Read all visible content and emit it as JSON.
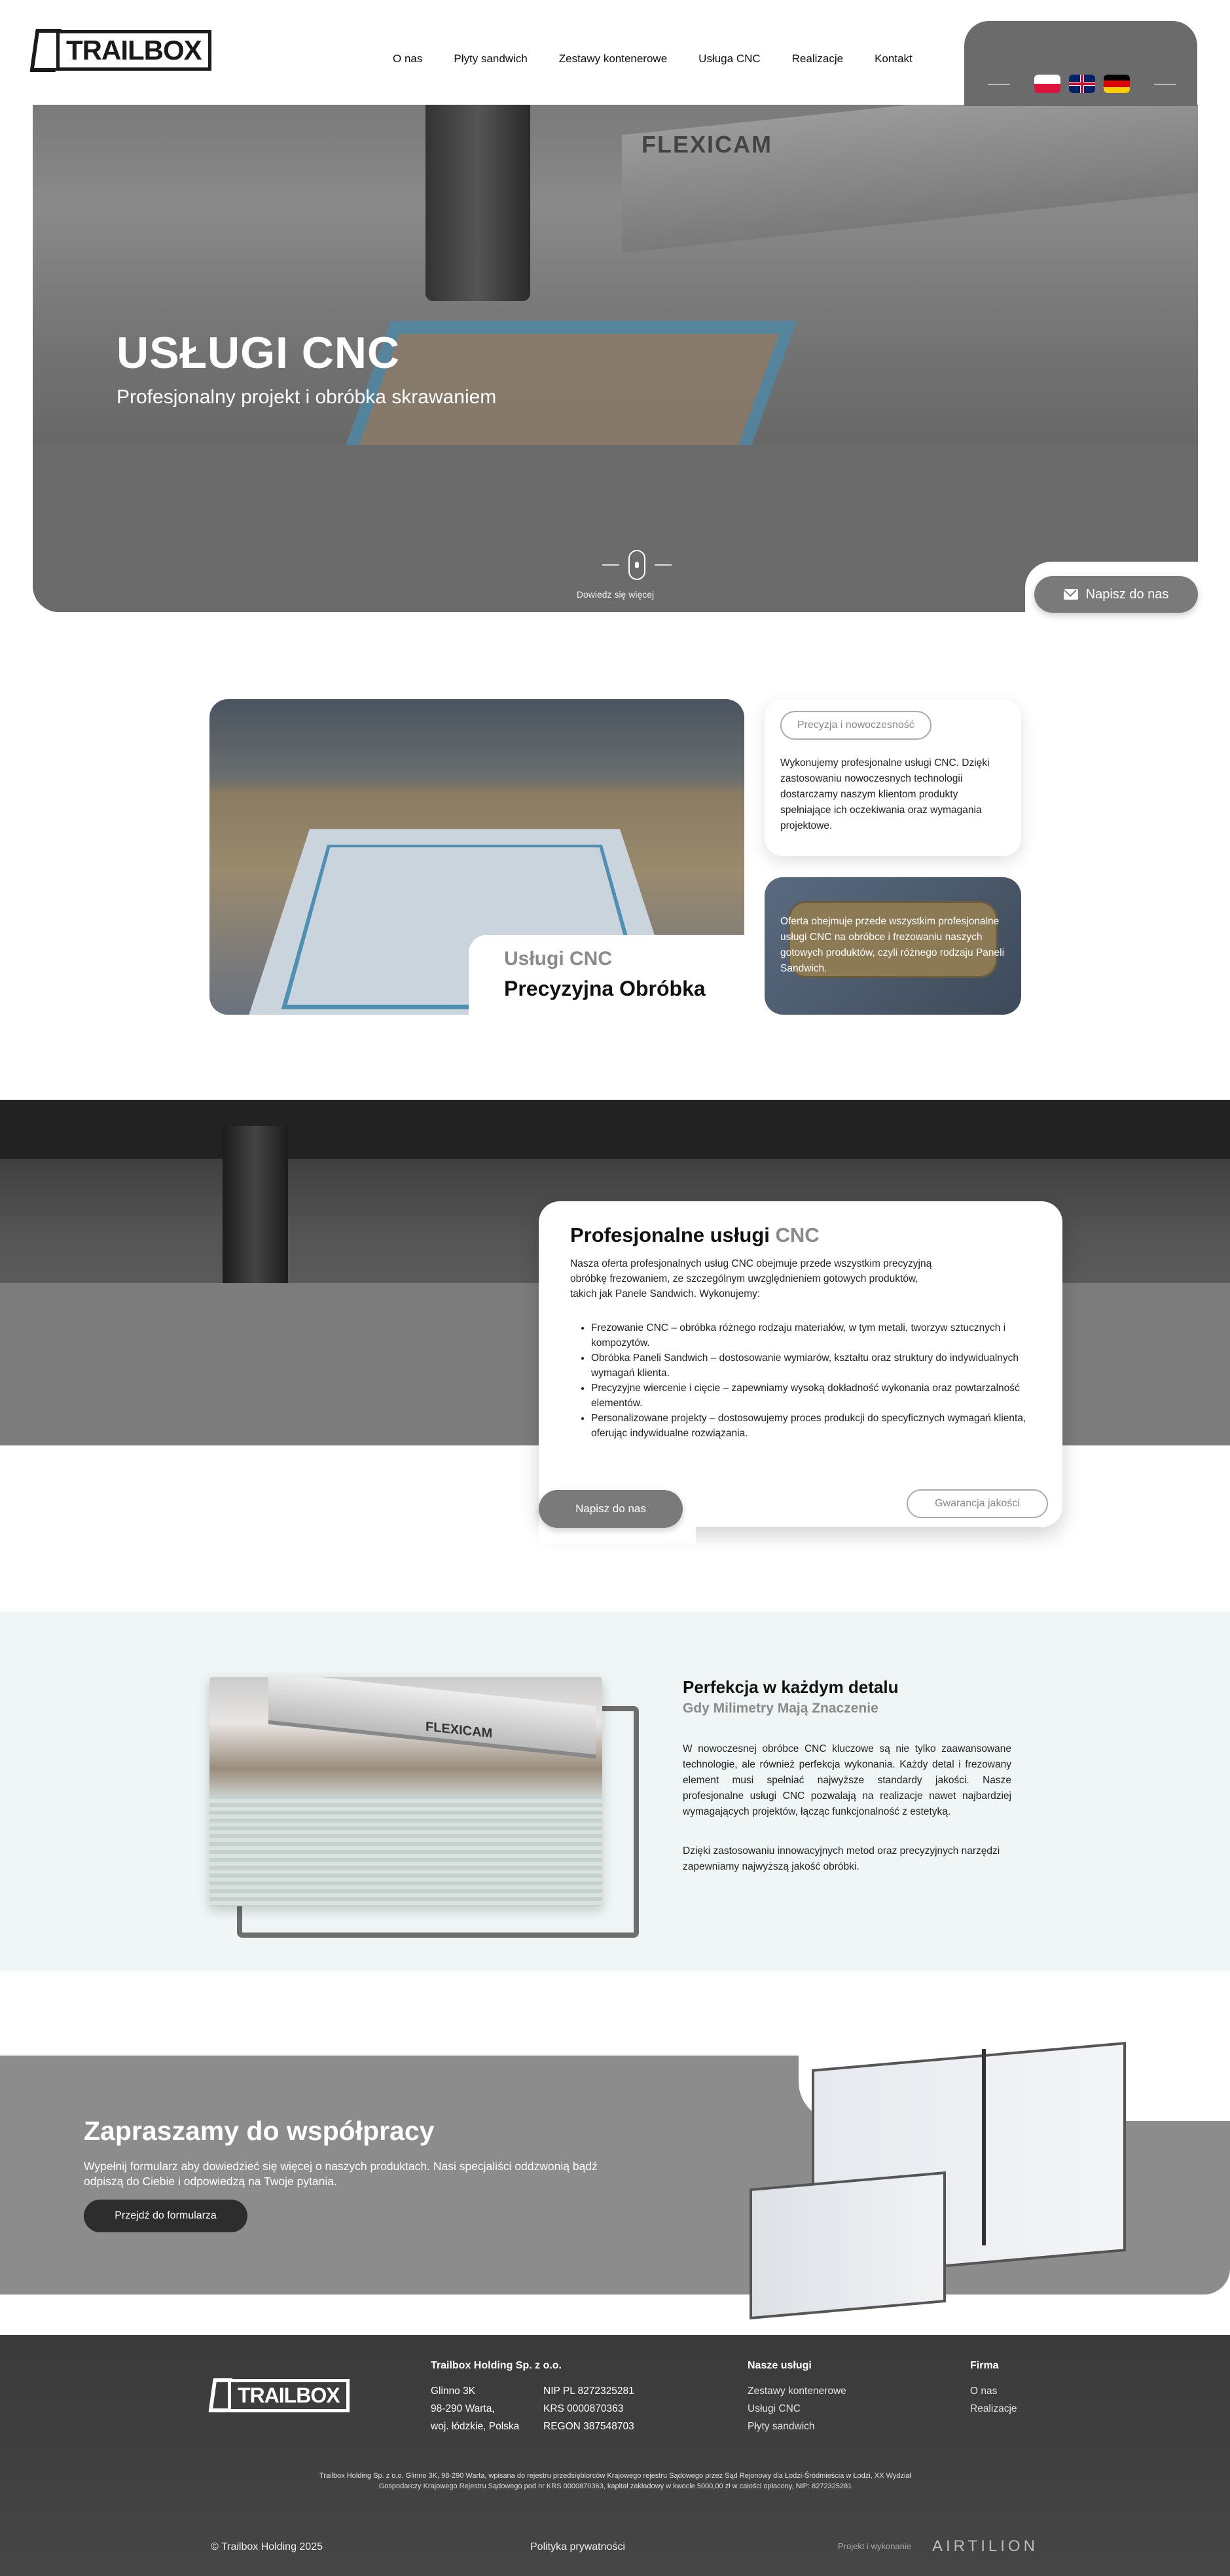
{
  "brand": {
    "logo_text": "TRAILBOX"
  },
  "nav": {
    "items": [
      "O nas",
      "Płyty sandwich",
      "Zestawy kontenerowe",
      "Usługa CNC",
      "Realizacje",
      "Kontakt"
    ]
  },
  "languages": [
    "pl",
    "en",
    "de"
  ],
  "hero": {
    "title": "USŁUGI CNC",
    "subtitle": "Profesjonalny projekt i obróbka skrawaniem",
    "scroll_label": "Dowiedz się więcej",
    "contact_button": "Napisz do nas"
  },
  "intro": {
    "label_gray": "Usługi CNC",
    "label_dark": "Precyzyjna Obróbka",
    "pill": "Precyzja i nowoczesność",
    "box1_text": "Wykonujemy profesjonalne usługi CNC. Dzięki zastosowaniu nowoczesnych technologii dostarczamy naszym klientom produkty spełniające ich oczekiwania oraz wymagania projektowe.",
    "box2_text": "Oferta obejmuje przede wszystkim profesjonalne usługi CNC na obróbce i frezowaniu naszych gotowych produktów, czyli różnego rodzaju Paneli Sandwich."
  },
  "services": {
    "title_dark": "Profesjonalne usługi",
    "title_gray": "CNC",
    "intro": "Nasza oferta profesjonalnych usług CNC obejmuje przede wszystkim precyzyjną obróbkę frezowaniem, ze szczególnym uwzględnieniem gotowych produktów, takich jak Panele Sandwich. Wykonujemy:",
    "list": [
      "Frezowanie CNC – obróbka różnego rodzaju materiałów, w tym metali, tworzyw sztucznych i kompozytów.",
      "Obróbka Paneli Sandwich – dostosowanie wymiarów, kształtu oraz struktury do indywidualnych wymagań klienta.",
      "Precyzyjne wiercenie i cięcie – zapewniamy wysoką dokładność wykonania oraz powtarzalność elementów.",
      "Personalizowane projekty – dostosowujemy proces produkcji do specyficznych wymagań klienta, oferując indywidualne rozwiązania."
    ],
    "button": "Napisz do nas",
    "pill": "Gwarancja jakości"
  },
  "detail": {
    "title": "Perfekcja w każdym detalu",
    "subtitle": "Gdy Milimetry Mają Znaczenie",
    "p1": "W nowoczesnej obróbce CNC kluczowe są nie tylko zaawansowane technologie, ale również perfekcja wykonania. Każdy detal i frezowany element musi spełniać najwyższe standardy jakości. Nasze profesjonalne usługi CNC pozwalają na realizacje nawet najbardziej wymagających projektów, łącząc funkcjonalność z estetyką.",
    "p2": "Dzięki zastosowaniu innowacyjnych metod oraz precyzyjnych narzędzi zapewniamy najwyższą jakość obróbki.",
    "image_label": "FLEXICAM"
  },
  "cta": {
    "title": "Zapraszamy do współpracy",
    "text": "Wypełnij formularz aby dowiedzieć się więcej o naszych produktach. Nasi specjaliści oddzwonią bądź odpiszą do Ciebie i odpowiedzą na Twoje pytania.",
    "button": "Przejdź do formularza"
  },
  "hero_image_label": "FLEXICAM",
  "footer": {
    "company": "Trailbox Holding Sp. z o.o.",
    "address": [
      "Glinno 3K",
      "98-290 Warta,",
      "woj. łódzkie, Polska"
    ],
    "ids": [
      "NIP PL 8272325281",
      "KRS 0000870363",
      "REGON 387548703"
    ],
    "col_services_title": "Nasze usługi",
    "services": [
      "Zestawy kontenerowe",
      "Usługi CNC",
      "Płyty sandwich"
    ],
    "col_company_title": "Firma",
    "company_links": [
      "O nas",
      "Realizacje"
    ],
    "legal": "Trailbox Holding Sp. z o.o. Glinno 3K, 98-290 Warta, wpisana do rejestru przedsiębiorców Krajowego rejestru Sądowego przez Sąd Rejonowy dla Łodzi-Śródmieścia w Łodzi, XX Wydział Gospodarczy Krajowego Rejestru Sądowego pod nr KRS 0000870363, kapitał zakładowy w kwocie 5000,00 zł w całości opłacony, NIP: 8272325281",
    "copyright": "© Trailbox Holding 2025",
    "privacy": "Polityka prywatności",
    "made_by": "Projekt i wykonanie",
    "made_by_brand": "AIRTILION"
  }
}
